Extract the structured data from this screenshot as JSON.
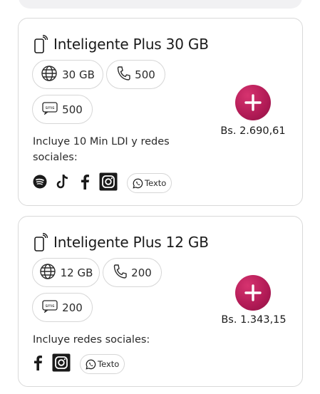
{
  "plans": [
    {
      "title": "Inteligente Plus 30 GB",
      "data": "30 GB",
      "minutes": "500",
      "sms": "500",
      "sms_icon_text": "sms",
      "price": "Bs. 2.690,61",
      "includes": "Incluye 10 Min LDI y redes sociales:",
      "texto_label": "Texto",
      "socials": [
        "spotify",
        "tiktok",
        "facebook",
        "instagram",
        "whatsapp"
      ]
    },
    {
      "title": "Inteligente Plus 12 GB",
      "data": "12 GB",
      "minutes": "200",
      "sms": "200",
      "sms_icon_text": "sms",
      "price": "Bs. 1.343,15",
      "includes": "Incluye redes sociales:",
      "texto_label": "Texto",
      "socials": [
        "facebook",
        "instagram",
        "whatsapp"
      ]
    }
  ],
  "colors": {
    "accent": "#b01a55",
    "border": "#d9d9d9"
  }
}
